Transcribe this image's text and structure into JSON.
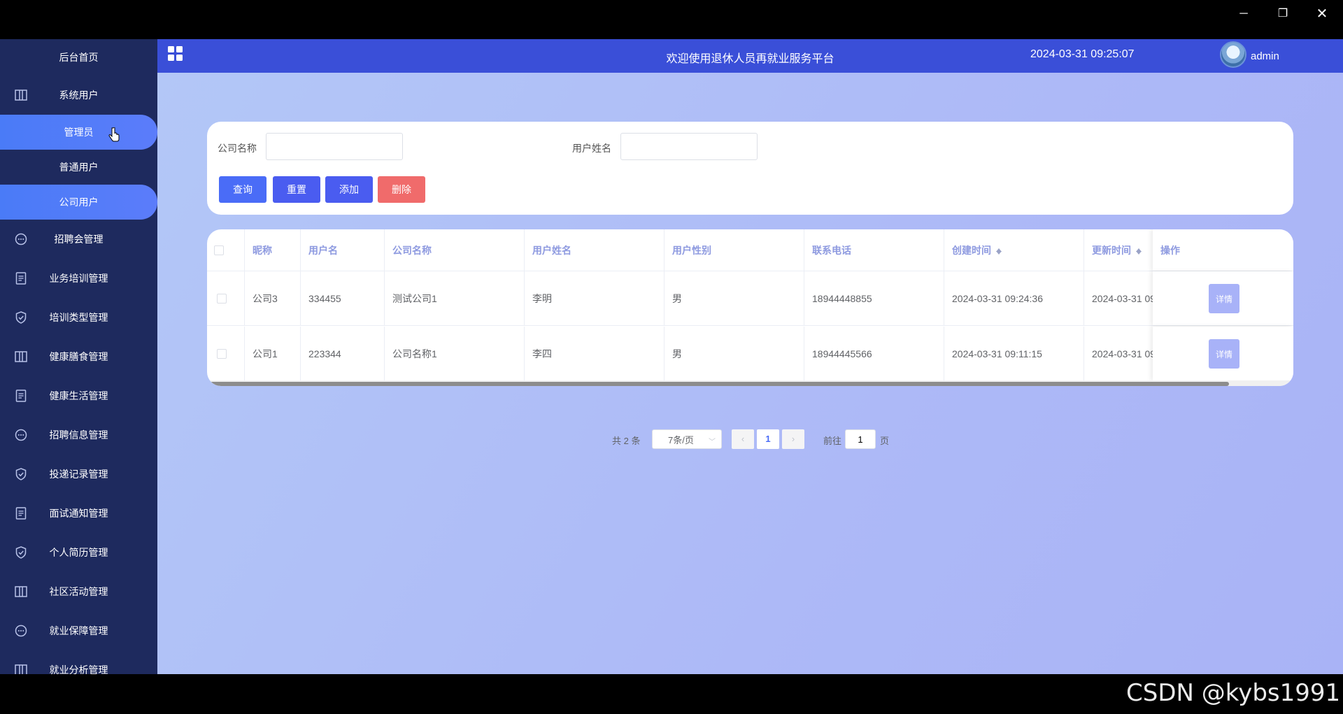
{
  "window": {
    "minimize": "─",
    "maximize": "❐",
    "close": "✕"
  },
  "sidebar": {
    "home": "后台首页",
    "system_users": "系统用户",
    "sub_items": [
      "管理员",
      "普通用户",
      "公司用户"
    ],
    "menu": [
      {
        "label": "招聘会管理",
        "icon": "chat-icon"
      },
      {
        "label": "业务培训管理",
        "icon": "document-icon"
      },
      {
        "label": "培训类型管理",
        "icon": "shield-check-icon"
      },
      {
        "label": "健康膳食管理",
        "icon": "columns-icon"
      },
      {
        "label": "健康生活管理",
        "icon": "document-icon"
      },
      {
        "label": "招聘信息管理",
        "icon": "chat-icon"
      },
      {
        "label": "投递记录管理",
        "icon": "shield-check-icon"
      },
      {
        "label": "面试通知管理",
        "icon": "document-icon"
      },
      {
        "label": "个人简历管理",
        "icon": "shield-check-icon"
      },
      {
        "label": "社区活动管理",
        "icon": "columns-icon"
      },
      {
        "label": "就业保障管理",
        "icon": "chat-icon"
      },
      {
        "label": "就业分析管理",
        "icon": "columns-icon"
      }
    ]
  },
  "header": {
    "title": "欢迎使用退休人员再就业服务平台",
    "datetime": "2024-03-31 09:25:07",
    "username": "admin"
  },
  "search": {
    "company_label": "公司名称",
    "company_value": "",
    "name_label": "用户姓名",
    "name_value": "",
    "buttons": {
      "query": "查询",
      "reset": "重置",
      "add": "添加",
      "delete": "删除"
    }
  },
  "table": {
    "columns": [
      "昵称",
      "用户名",
      "公司名称",
      "用户姓名",
      "用户性别",
      "联系电话",
      "创建时间",
      "更新时间",
      "操作"
    ],
    "rows": [
      [
        "公司3",
        "334455",
        "测试公司1",
        "李明",
        "男",
        "18944448855",
        "2024-03-31 09:24:36",
        "2024-03-31 09"
      ],
      [
        "公司1",
        "223344",
        "公司名称1",
        "李四",
        "男",
        "18944445566",
        "2024-03-31 09:11:15",
        "2024-03-31 09"
      ]
    ],
    "detail_label": "详情"
  },
  "pagination": {
    "total": "共 2 条",
    "page_size": "7条/页",
    "current_page": "1",
    "goto_label": "前往",
    "goto_value": "1",
    "page_suffix": "页"
  },
  "watermark": "CSDN @kybs1991"
}
